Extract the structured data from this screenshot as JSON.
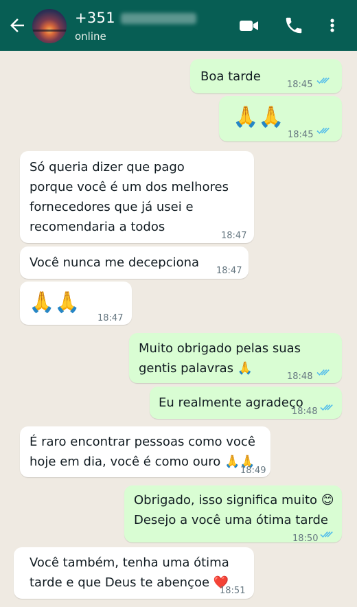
{
  "header": {
    "contact_name": "+351",
    "status": "online",
    "colors": {
      "bar": "#075e54",
      "incoming_bubble": "#ffffff",
      "outgoing_bubble": "#d9fdd3",
      "chat_background": "#efeae2",
      "read_ticks": "#53bdeb"
    },
    "icons": [
      "back-arrow-icon",
      "avatar",
      "video-call-icon",
      "phone-icon",
      "more-options-icon"
    ]
  },
  "messages": [
    {
      "direction": "out",
      "text": "Boa tarde",
      "time": "18:45",
      "status": "read"
    },
    {
      "direction": "out",
      "text": "🙏🙏",
      "time": "18:45",
      "status": "read"
    },
    {
      "direction": "in",
      "text": "Só queria dizer que pago\nporque você é um dos melhores\nfornecedores que já usei e\nrecomendaria a todos",
      "time": "18:47"
    },
    {
      "direction": "in",
      "text": "Você nunca me decepciona",
      "time": "18:47"
    },
    {
      "direction": "in",
      "text": "🙏🙏",
      "time": "18:47"
    },
    {
      "direction": "out",
      "text": "Muito obrigado pelas suas\ngentis palavras 🙏",
      "time": "18:48",
      "status": "read"
    },
    {
      "direction": "out",
      "text": "Eu realmente agradeço",
      "time": "18:48",
      "status": "read"
    },
    {
      "direction": "in",
      "text": "É raro encontrar pessoas como você\nhoje em dia, você é como ouro 🙏🙏",
      "time": "18:49"
    },
    {
      "direction": "out",
      "text": "Obrigado, isso significa muito 😊\nDesejo a você uma ótima tarde",
      "time": "18:50",
      "status": "read"
    },
    {
      "direction": "in",
      "text": "Você também, tenha uma ótima\ntarde e que Deus te abençoe ❤️",
      "time": "18:51"
    }
  ]
}
